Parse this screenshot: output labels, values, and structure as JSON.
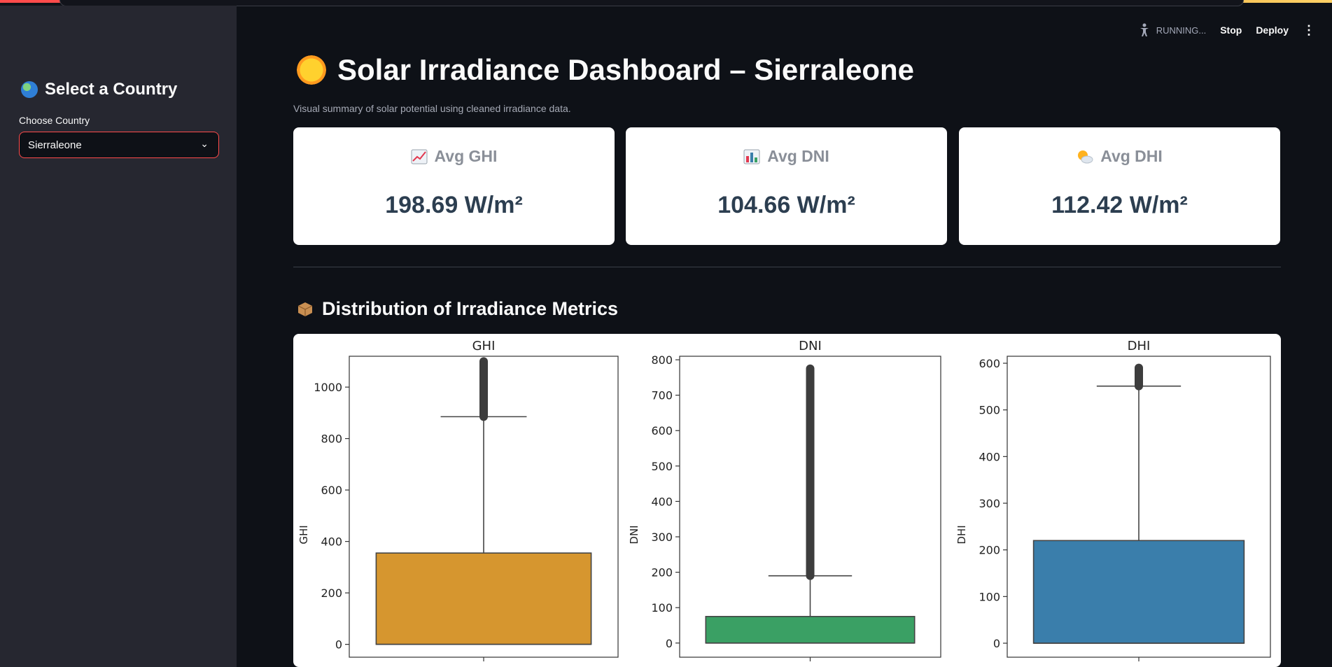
{
  "sidebar": {
    "title": "Select a Country",
    "title_icon": "globe-icon",
    "select_label": "Choose Country",
    "selected_country": "Sierraleone"
  },
  "toolbar": {
    "status": "RUNNING...",
    "stop_label": "Stop",
    "deploy_label": "Deploy"
  },
  "main": {
    "title": "Solar Irradiance Dashboard – Sierraleone",
    "title_icon": "sun-icon",
    "caption": "Visual summary of solar potential using cleaned irradiance data.",
    "metrics": [
      {
        "label": "Avg GHI",
        "value": "198.69 W/m²",
        "icon": "chart-increasing-icon"
      },
      {
        "label": "Avg DNI",
        "value": "104.66 W/m²",
        "icon": "bar-chart-icon"
      },
      {
        "label": "Avg DHI",
        "value": "112.42 W/m²",
        "icon": "sun-behind-cloud-icon"
      }
    ],
    "section_title": "Distribution of Irradiance Metrics",
    "section_icon": "package-icon"
  },
  "colors": {
    "accent": "#ff4b4b",
    "ghi": "#d6962f",
    "dni": "#3aa064",
    "dhi": "#3a7eab"
  },
  "chart_data": [
    {
      "type": "box",
      "title": "GHI",
      "ylabel": "GHI",
      "ylim": [
        -50,
        1120
      ],
      "yticks": [
        0,
        200,
        400,
        600,
        800,
        1000
      ],
      "box": {
        "min": 0,
        "q1": 0,
        "median": 0,
        "q3": 355,
        "whisker_high": 885,
        "outliers_from": 885,
        "outliers_to": 1100
      },
      "color": "#d6962f"
    },
    {
      "type": "box",
      "title": "DNI",
      "ylabel": "DNI",
      "ylim": [
        -40,
        810
      ],
      "yticks": [
        0,
        100,
        200,
        300,
        400,
        500,
        600,
        700,
        800
      ],
      "box": {
        "min": 0,
        "q1": 0,
        "median": 0,
        "q3": 75,
        "whisker_high": 190,
        "outliers_from": 190,
        "outliers_to": 775
      },
      "color": "#3aa064"
    },
    {
      "type": "box",
      "title": "DHI",
      "ylabel": "DHI",
      "ylim": [
        -30,
        615
      ],
      "yticks": [
        0,
        100,
        200,
        300,
        400,
        500,
        600
      ],
      "box": {
        "min": 0,
        "q1": 0,
        "median": 0,
        "q3": 220,
        "whisker_high": 551,
        "outliers_from": 551,
        "outliers_to": 590
      },
      "color": "#3a7eab"
    }
  ]
}
